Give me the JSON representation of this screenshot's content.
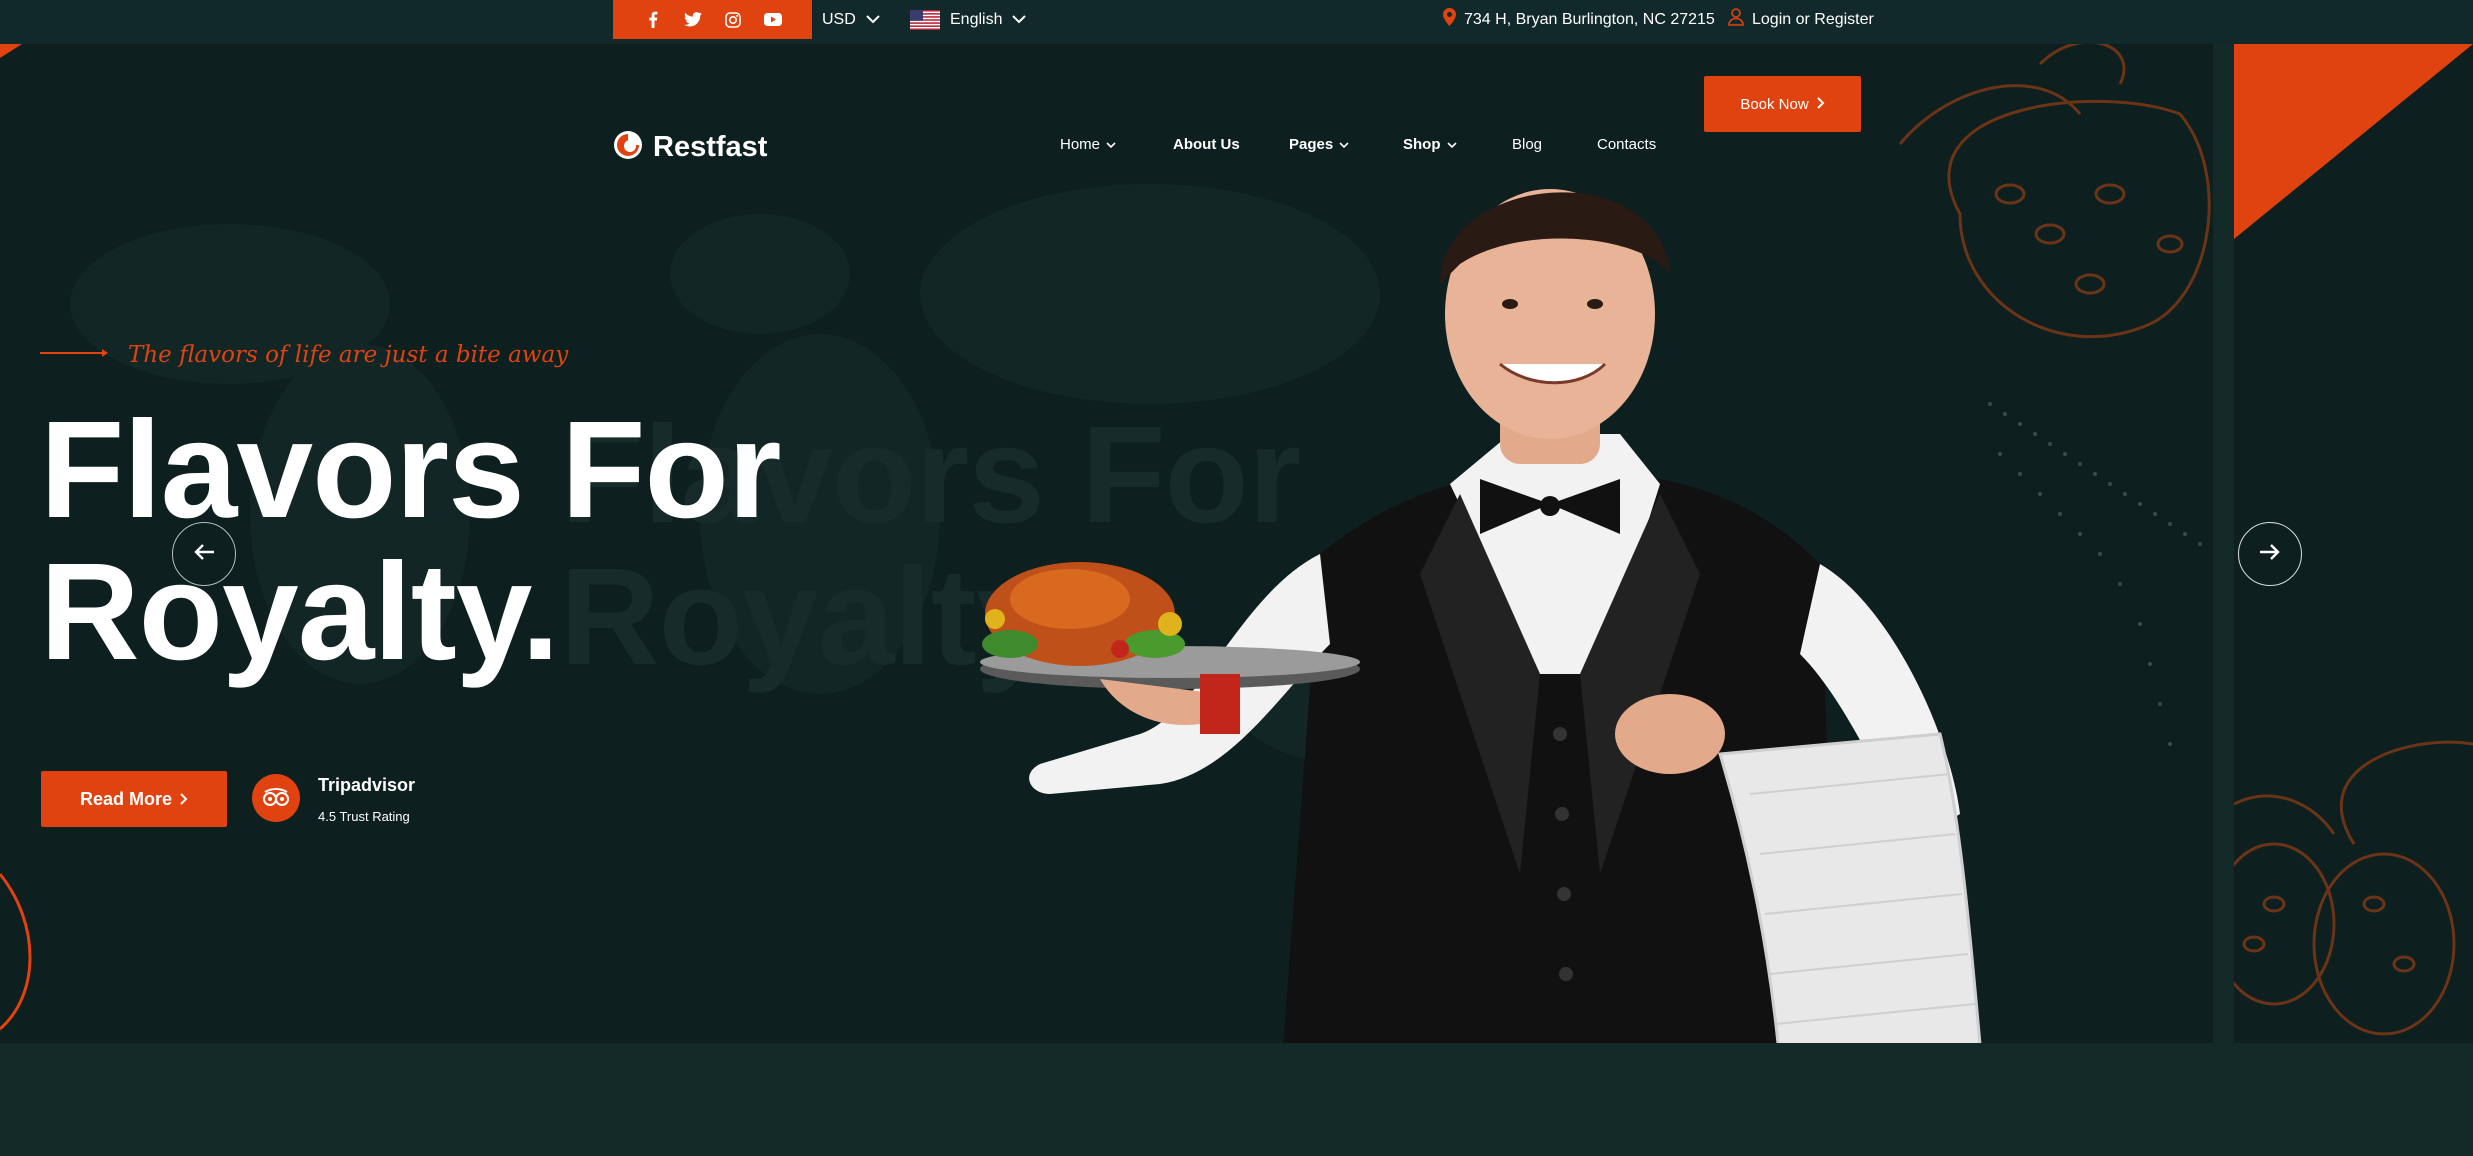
{
  "topbar": {
    "social_icons": [
      "facebook-icon",
      "twitter-icon",
      "instagram-icon",
      "youtube-icon"
    ],
    "currency": "USD",
    "language": "English",
    "address": "734 H, Bryan Burlington, NC 27215",
    "login": "Login or Register"
  },
  "header": {
    "logo": "Restfast",
    "nav": [
      {
        "label": "Home",
        "dropdown": true
      },
      {
        "label": "About Us",
        "dropdown": false
      },
      {
        "label": "Pages",
        "dropdown": true
      },
      {
        "label": "Shop",
        "dropdown": true
      },
      {
        "label": "Blog",
        "dropdown": false
      },
      {
        "label": "Contacts",
        "dropdown": false
      }
    ],
    "book_now": "Book Now"
  },
  "hero": {
    "tagline": "The flavors of life are just a bite away",
    "title_line1": "Flavors For",
    "title_line2": "Royalty.",
    "ghost_line1": "Flavors For",
    "ghost_line2": "Royalty.",
    "read_more": "Read More",
    "rating_name": "Tripadvisor",
    "rating_text": "4.5 Trust Rating"
  },
  "colors": {
    "accent": "#e0430f",
    "background": "#0d1f1f",
    "bar": "#11292a"
  }
}
